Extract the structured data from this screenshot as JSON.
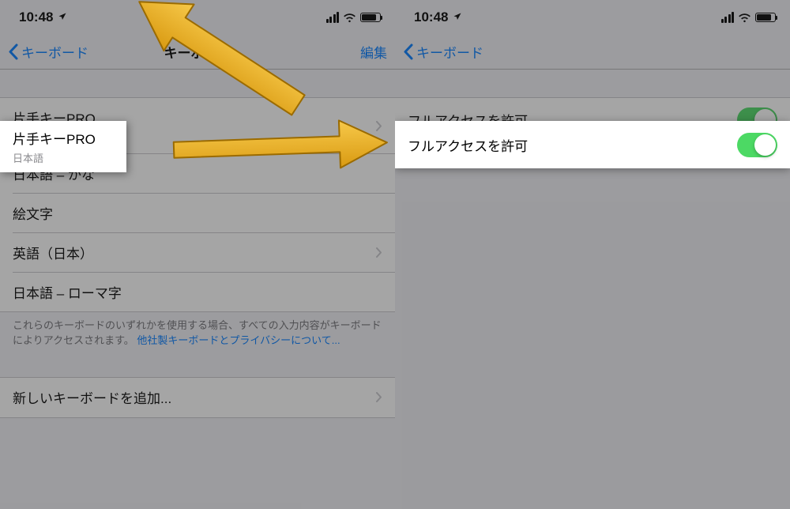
{
  "status": {
    "time": "10:48",
    "location_icon": "location-arrow"
  },
  "left": {
    "back_label": "キーボード",
    "title": "キーボード",
    "edit_label": "編集",
    "rows": [
      {
        "title": "片手キーPRO",
        "subtitle": "日本語",
        "chevron": true
      },
      {
        "title": "日本語 – かな",
        "chevron": false
      },
      {
        "title": "絵文字",
        "chevron": false
      },
      {
        "title": "英語（日本）",
        "chevron": true
      },
      {
        "title": "日本語 – ローマ字",
        "chevron": false
      }
    ],
    "footer_text": "これらのキーボードのいずれかを使用する場合、すべての入力内容がキーボードによりアクセスされます。",
    "footer_link": "他社製キーボードとプライバシーについて...",
    "add_row": "新しいキーボードを追加..."
  },
  "right": {
    "back_label": "キーボード",
    "toggle_label": "フルアクセスを許可",
    "toggle_on": true
  },
  "highlight_left": {
    "title": "片手キーPRO",
    "subtitle": "日本語"
  },
  "highlight_right": {
    "label": "フルアクセスを許可"
  }
}
